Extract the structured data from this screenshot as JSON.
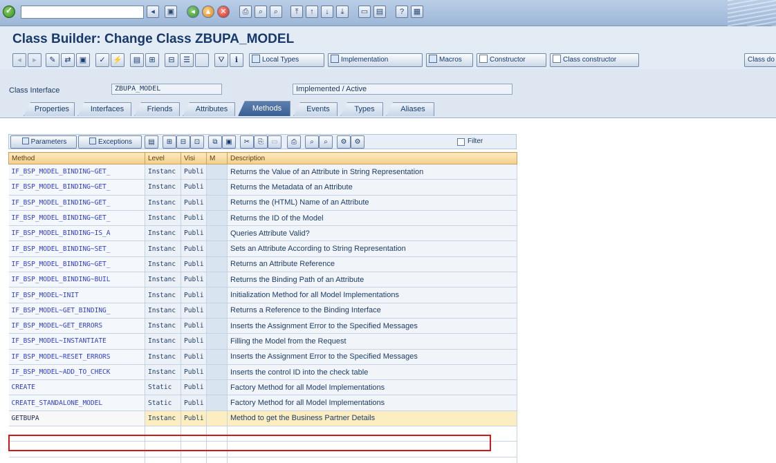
{
  "title": "Class Builder: Change Class ZBUPA_MODEL",
  "app_toolbar": {
    "local_types": "Local Types",
    "implementation": "Implementation",
    "macros": "Macros",
    "constructor": "Constructor",
    "class_constructor": "Class constructor",
    "class_doc": "Class do"
  },
  "header": {
    "class_interface_label": "Class Interface",
    "class_name": "ZBUPA_MODEL",
    "status": "Implemented / Active"
  },
  "tabs": [
    {
      "label": "Properties"
    },
    {
      "label": "Interfaces"
    },
    {
      "label": "Friends"
    },
    {
      "label": "Attributes"
    },
    {
      "label": "Methods"
    },
    {
      "label": "Events"
    },
    {
      "label": "Types"
    },
    {
      "label": "Aliases"
    }
  ],
  "grid_toolbar": {
    "parameters": "Parameters",
    "exceptions": "Exceptions",
    "filter": "Filter"
  },
  "columns": {
    "method": "Method",
    "level": "Level",
    "visibility": "Visi",
    "m": "M",
    "description": "Description"
  },
  "rows": [
    {
      "method": "IF_BSP_MODEL_BINDING~GET_",
      "level": "Instanc",
      "visi": "Publi",
      "desc": "Returns the Value of an Attribute in String Representation"
    },
    {
      "method": "IF_BSP_MODEL_BINDING~GET_",
      "level": "Instanc",
      "visi": "Publi",
      "desc": "Returns the Metadata of an Attribute"
    },
    {
      "method": "IF_BSP_MODEL_BINDING~GET_",
      "level": "Instanc",
      "visi": "Publi",
      "desc": "Returns the (HTML) Name of an Attribute"
    },
    {
      "method": "IF_BSP_MODEL_BINDING~GET_",
      "level": "Instanc",
      "visi": "Publi",
      "desc": "Returns the ID of the Model"
    },
    {
      "method": "IF_BSP_MODEL_BINDING~IS_A",
      "level": "Instanc",
      "visi": "Publi",
      "desc": "Queries Attribute Valid?"
    },
    {
      "method": "IF_BSP_MODEL_BINDING~SET_",
      "level": "Instanc",
      "visi": "Publi",
      "desc": "Sets an Attribute According to String Representation"
    },
    {
      "method": "IF_BSP_MODEL_BINDING~GET_",
      "level": "Instanc",
      "visi": "Publi",
      "desc": "Returns an Attribute Reference"
    },
    {
      "method": "IF_BSP_MODEL_BINDING~BUIL",
      "level": "Instanc",
      "visi": "Publi",
      "desc": "Returns the Binding Path of an Attribute"
    },
    {
      "method": "IF_BSP_MODEL~INIT",
      "level": "Instanc",
      "visi": "Publi",
      "desc": "Initialization Method for all Model Implementations"
    },
    {
      "method": "IF_BSP_MODEL~GET_BINDING_",
      "level": "Instanc",
      "visi": "Publi",
      "desc": "Returns a Reference to the Binding Interface"
    },
    {
      "method": "IF_BSP_MODEL~GET_ERRORS",
      "level": "Instanc",
      "visi": "Publi",
      "desc": "Inserts the Assignment Error to the Specified Messages"
    },
    {
      "method": "IF_BSP_MODEL~INSTANTIATE",
      "level": "Instanc",
      "visi": "Publi",
      "desc": "Filling the Model from the Request"
    },
    {
      "method": "IF_BSP_MODEL~RESET_ERRORS",
      "level": "Instanc",
      "visi": "Publi",
      "desc": "Inserts the Assignment Error to the Specified Messages"
    },
    {
      "method": "IF_BSP_MODEL~ADD_TO_CHECK",
      "level": "Instanc",
      "visi": "Publi",
      "desc": "Inserts the control ID into the check table"
    },
    {
      "method": "CREATE",
      "level": "Static",
      "visi": "Publi",
      "desc": "Factory Method for all Model Implementations"
    },
    {
      "method": "CREATE_STANDALONE_MODEL",
      "level": "Static",
      "visi": "Publi",
      "desc": "Factory Method for all Model Implementations"
    },
    {
      "method": "GETBUPA",
      "level": "Instanc",
      "visi": "Publi",
      "desc": "Method to get the Business Partner Details"
    }
  ],
  "colors": {
    "accent": "#183a6b",
    "highlight_border": "#d01818",
    "header_row": "#f2cf88",
    "selected_row": "#fdeec2"
  }
}
